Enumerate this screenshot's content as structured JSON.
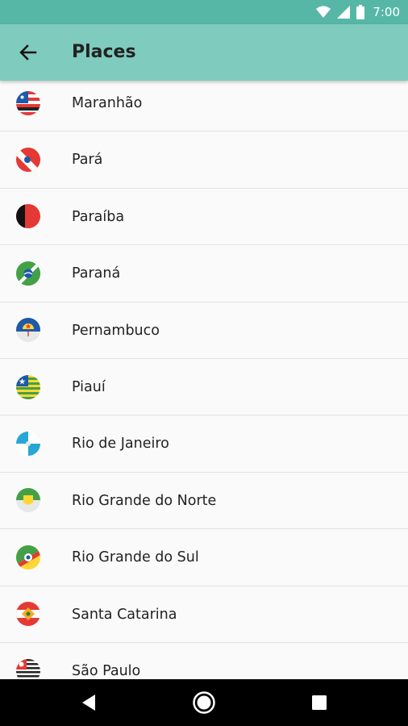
{
  "status_bar": {
    "time": "7:00",
    "icons": [
      "wifi-icon",
      "signal-icon",
      "battery-icon"
    ]
  },
  "app_bar": {
    "back_icon": "arrow-back-icon",
    "title": "Places"
  },
  "places": [
    {
      "label": "Maranhão",
      "flag": "maranhao-flag-icon"
    },
    {
      "label": "Pará",
      "flag": "para-flag-icon"
    },
    {
      "label": "Paraíba",
      "flag": "paraiba-flag-icon"
    },
    {
      "label": "Paraná",
      "flag": "parana-flag-icon"
    },
    {
      "label": "Pernambuco",
      "flag": "pernambuco-flag-icon"
    },
    {
      "label": "Piauí",
      "flag": "piaui-flag-icon"
    },
    {
      "label": "Rio de Janeiro",
      "flag": "rio-de-janeiro-flag-icon"
    },
    {
      "label": "Rio Grande do Norte",
      "flag": "rio-grande-do-norte-flag-icon"
    },
    {
      "label": "Rio Grande do Sul",
      "flag": "rio-grande-do-sul-flag-icon"
    },
    {
      "label": "Santa Catarina",
      "flag": "santa-catarina-flag-icon"
    },
    {
      "label": "São Paulo",
      "flag": "sao-paulo-flag-icon"
    }
  ],
  "nav_bar": {
    "icons": [
      "back-triangle-icon",
      "home-circle-icon",
      "recents-square-icon"
    ]
  },
  "colors": {
    "status_bar": "#57b7a7",
    "app_bar": "#7fcbbe",
    "background": "#fafafa",
    "divider": "#e2e2e2"
  }
}
